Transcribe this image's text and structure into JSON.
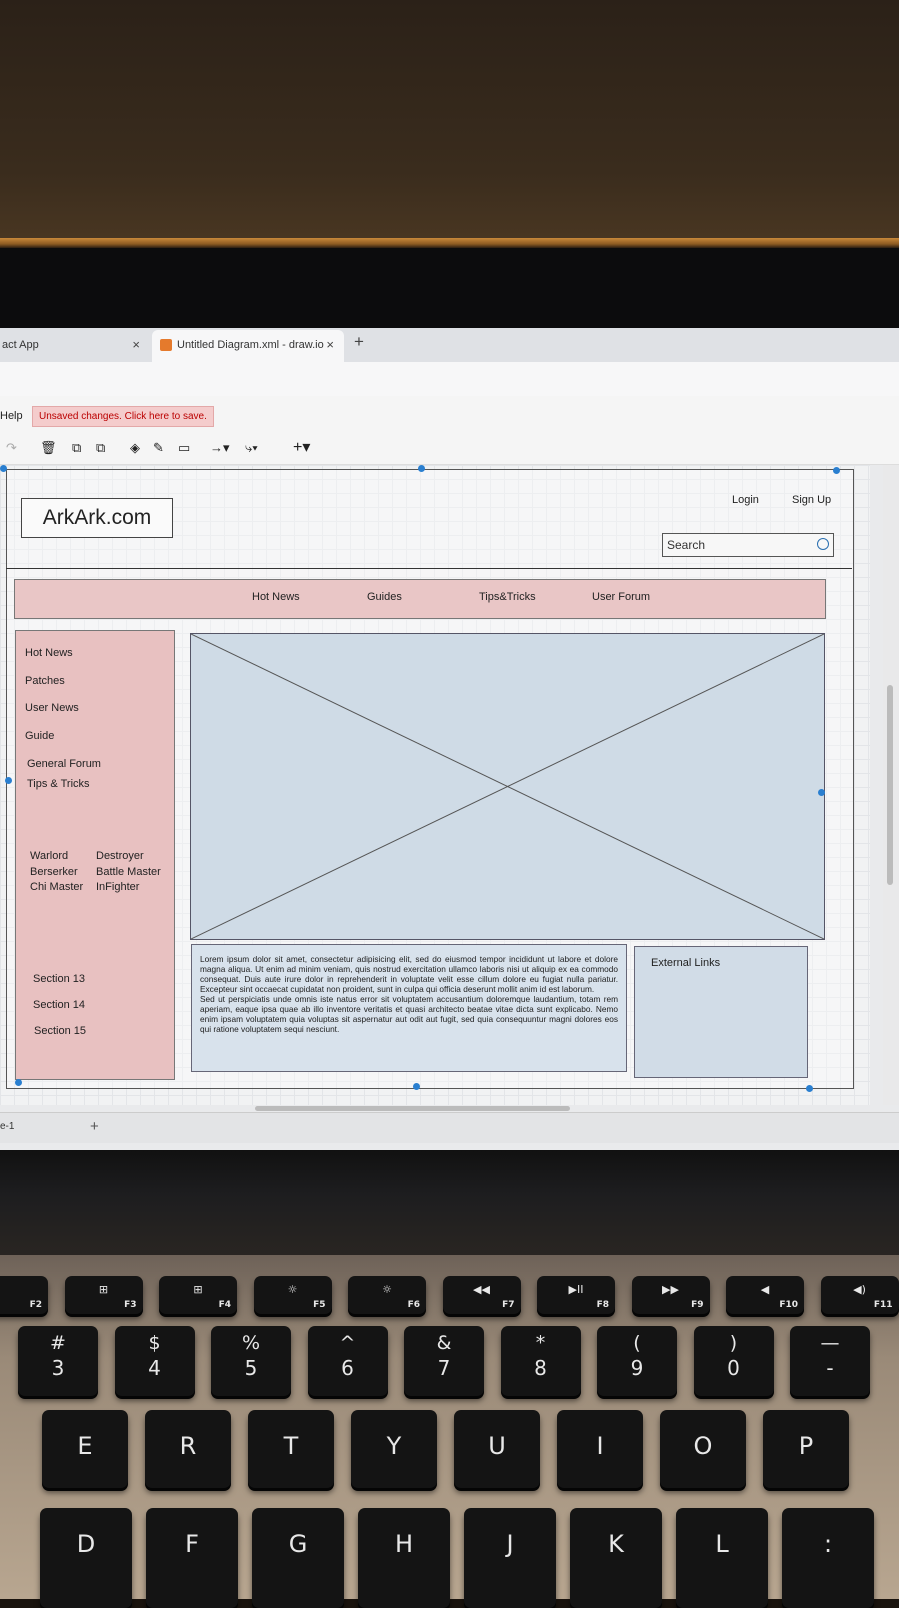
{
  "browser": {
    "tabs": [
      {
        "label": "act App",
        "close": "×"
      },
      {
        "label": "Untitled Diagram.xml - draw.io",
        "close": "×"
      }
    ],
    "new_tab": "+"
  },
  "drawio": {
    "menu_help": "Help",
    "unsaved_notice": "Unsaved changes. Click here to save.",
    "toolbar_icons": [
      "redo-icon",
      "delete-icon",
      "to-front-icon",
      "to-back-icon",
      "fill-color-icon",
      "line-color-icon",
      "shadow-icon",
      "connection-icon",
      "waypoints-icon",
      "insert-icon"
    ],
    "page_tab": "e-1",
    "add_page": "+"
  },
  "wireframe": {
    "logo": "ArkArk.com",
    "login": "Login",
    "signup": "Sign Up",
    "search_placeholder": "Search",
    "nav": [
      "Hot News",
      "Guides",
      "Tips&Tricks",
      "User Forum"
    ],
    "sidebar_links": [
      "Hot News",
      "Patches",
      "User News",
      "Guide",
      "General Forum",
      "Tips & Tricks"
    ],
    "classes_col1": [
      "Warlord",
      "Berserker",
      "Chi Master"
    ],
    "classes_col2": [
      "Destroyer",
      "Battle Master",
      "InFighter"
    ],
    "sections": [
      "Section 13",
      "Section 14",
      "Section 15"
    ],
    "lorem": "Lorem ipsum dolor sit amet, consectetur adipisicing elit, sed do eiusmod tempor incididunt ut labore et dolore magna aliqua. Ut enim ad minim veniam, quis nostrud exercitation ullamco laboris nisi ut aliquip ex ea commodo consequat. Duis aute irure dolor in reprehenderit in voluptate velit esse cillum dolore eu fugiat nulla pariatur. Excepteur sint occaecat cupidatat non proident, sunt in culpa qui officia deserunt mollit anim id est laborum.",
    "lorem2": "Sed ut perspiciatis unde omnis iste natus error sit voluptatem accusantium doloremque laudantium, totam rem aperiam, eaque ipsa quae ab illo inventore veritatis et quasi architecto beatae vitae dicta sunt explicabo. Nemo enim ipsam voluptatem quia voluptas sit aspernatur aut odit aut fugit, sed quia consequuntur magni dolores eos qui ratione voluptatem sequi nesciunt.",
    "external_links": "External Links"
  },
  "keyboard": {
    "fkeys": [
      "F2",
      "F3",
      "F4",
      "F5",
      "F6",
      "F7",
      "F8",
      "F9",
      "F10",
      "F11"
    ],
    "numkeys": [
      {
        "top": "#",
        "bot": "3"
      },
      {
        "top": "$",
        "bot": "4"
      },
      {
        "top": "%",
        "bot": "5"
      },
      {
        "top": "^",
        "bot": "6"
      },
      {
        "top": "&",
        "bot": "7"
      },
      {
        "top": "*",
        "bot": "8"
      },
      {
        "top": "(",
        "bot": "9"
      },
      {
        "top": ")",
        "bot": "0"
      },
      {
        "top": "—",
        "bot": "-"
      }
    ],
    "row_qwerty": [
      "E",
      "R",
      "T",
      "Y",
      "U",
      "I",
      "O",
      "P"
    ],
    "row_home": [
      "D",
      "F",
      "G",
      "H",
      "J",
      "K",
      "L",
      ":"
    ]
  }
}
